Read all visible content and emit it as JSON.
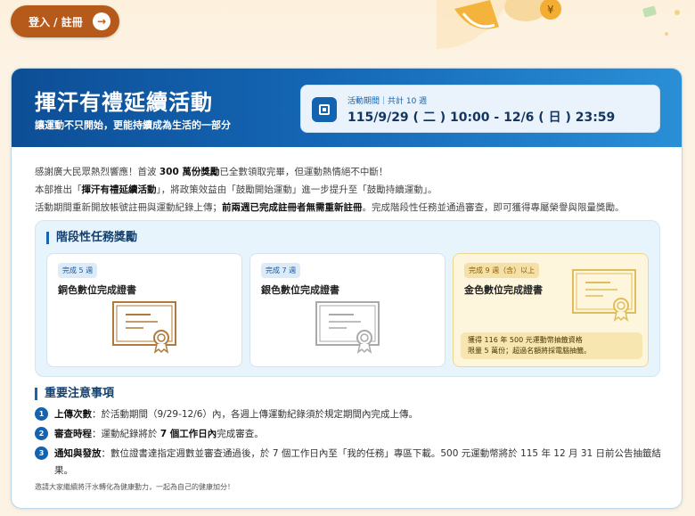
{
  "top": {
    "login_label": "登入 / 註冊",
    "login_arrow": "→"
  },
  "header": {
    "title": "揮汗有禮延續活動",
    "subtitle": "讓運動不只開始，更能持續成為生活的一部分",
    "period_label": "活動期間｜共計 10 週",
    "period_value": "115/9/29 ( 二 ) 10:00 - 12/6 ( 日 ) 23:59"
  },
  "intro": {
    "line1_a": "感謝廣大民眾熱烈響應！首波 ",
    "line1_b": "300 萬份獎勵",
    "line1_c": "已全數領取完畢，但運動熱情絕不中斷！",
    "line2_a": "本部推出「",
    "line2_b": "揮汗有禮延續活動",
    "line2_c": "」，將政策效益由「鼓勵開始運動」進一步提升至「鼓勵持續運動」。",
    "line3_a": "活動期間重新開放帳號註冊與運動紀錄上傳；",
    "line3_b": "前兩週已完成註冊者無需重新註冊",
    "line3_c": "。完成階段性任務並通過審查，即可獲得專屬榮譽與限量獎勵。"
  },
  "tasks": {
    "title": "階段性任務獎勵",
    "items": [
      {
        "tag": "完成 5 週",
        "name": "銅色數位完成證書",
        "color": "#b07a3a"
      },
      {
        "tag": "完成 7 週",
        "name": "銀色數位完成證書",
        "color": "#a9a9a9"
      },
      {
        "tag": "完成 9 週（含）以上",
        "name": "金色數位完成證書",
        "color": "#e0bd5a",
        "note1": "獲得 116 年 500 元運動幣抽籤資格",
        "note2": "限量 5 萬份；超過名額將採電腦抽籤。"
      }
    ]
  },
  "notes": {
    "title": "重要注意事項",
    "items": [
      {
        "num": "1",
        "label": "上傳次數",
        "text": "：於活動期間（9/29-12/6）內，各週上傳運動紀錄須於規定期間內完成上傳。"
      },
      {
        "num": "2",
        "label": "審查時程",
        "text_a": "：運動紀錄將於 ",
        "text_b": "7 個工作日內",
        "text_c": "完成審查。"
      },
      {
        "num": "3",
        "label": "通知與發放",
        "text": "：數位證書達指定週數並審查通過後，於 7 個工作日內至「我的任務」專區下載。500 元運動幣將於 115 年 12 月 31 日前公告抽籤結果。"
      }
    ]
  },
  "footer": "邀請大家繼續將汗水轉化為健康動力，一起為自己的健康加分！"
}
